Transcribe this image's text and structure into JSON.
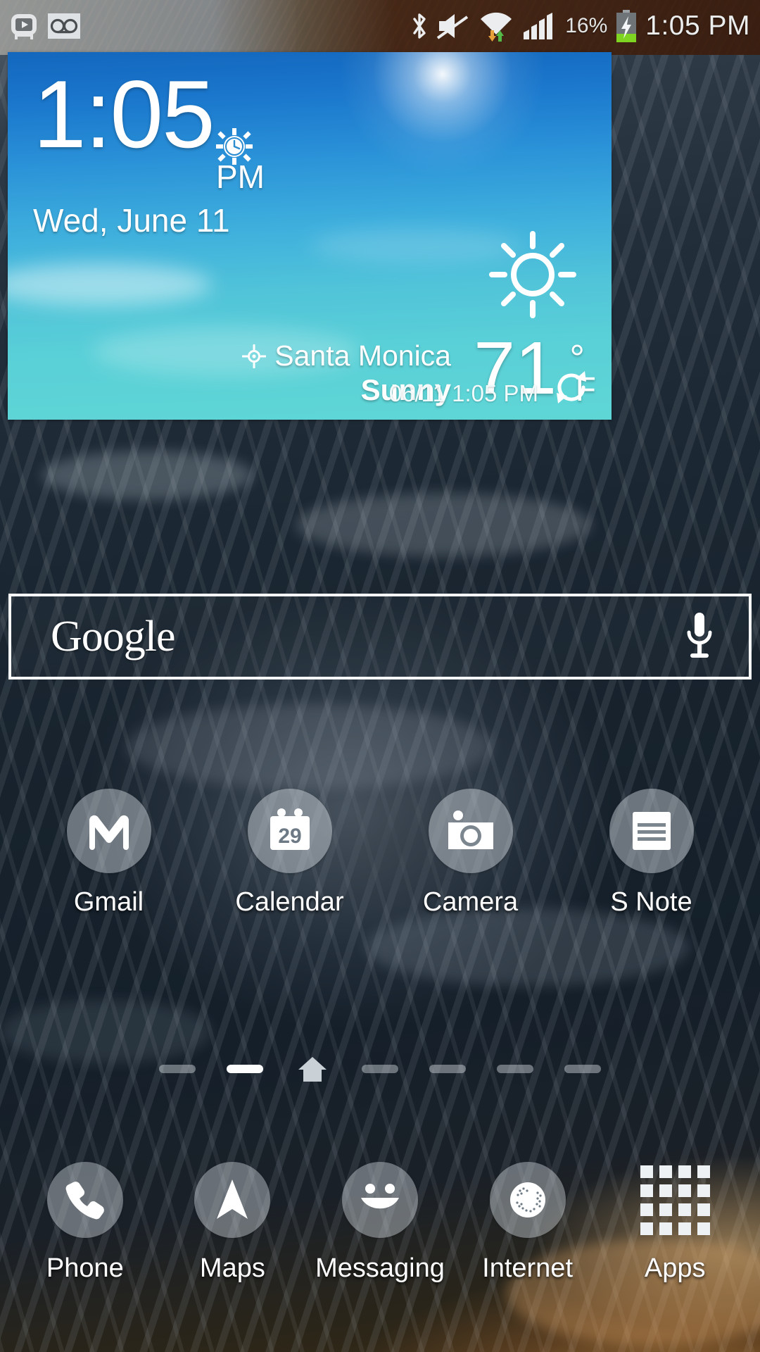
{
  "status_bar": {
    "left_icons": [
      {
        "name": "screen-recorder-icon",
        "label": "Screen recorder"
      },
      {
        "name": "voicemail-icon",
        "label": "Voicemail"
      }
    ],
    "right_icons": [
      {
        "name": "bluetooth-icon",
        "label": "Bluetooth"
      },
      {
        "name": "sound-mute-icon",
        "label": "Sound muted"
      },
      {
        "name": "wifi-icon",
        "label": "Wi-Fi with data transfer"
      },
      {
        "name": "cellular-signal-icon",
        "label": "Cellular signal"
      }
    ],
    "battery_percent": "16%",
    "battery_state": "charging",
    "clock": "1:05 PM"
  },
  "weather_widget": {
    "time": "1:05",
    "meridiem": "PM",
    "date": "Wed, June 11",
    "alarm_icon": "alarm-clock-icon",
    "condition_icon": "sunny-icon",
    "location": "Santa Monica",
    "condition": "Sunny",
    "temperature": "71",
    "degree_symbol": "°",
    "unit": "F",
    "updated": "06/11 1:05 PM",
    "refresh_icon": "refresh-icon"
  },
  "search": {
    "brand": "Google",
    "mic_icon": "microphone-icon"
  },
  "apps": [
    {
      "label": "Gmail",
      "icon": "gmail-icon"
    },
    {
      "label": "Calendar",
      "icon": "calendar-icon",
      "badge": "29"
    },
    {
      "label": "Camera",
      "icon": "camera-icon"
    },
    {
      "label": "S Note",
      "icon": "s-note-icon"
    }
  ],
  "page_indicator": {
    "pages": 7,
    "active_index": 1,
    "home_index": 2,
    "home_icon": "home-icon"
  },
  "dock": [
    {
      "label": "Phone",
      "icon": "phone-icon"
    },
    {
      "label": "Maps",
      "icon": "navigation-arrow-icon"
    },
    {
      "label": "Messaging",
      "icon": "smiley-face-icon"
    },
    {
      "label": "Internet",
      "icon": "globe-icon"
    },
    {
      "label": "Apps",
      "icon": "apps-grid-icon"
    }
  ],
  "colors": {
    "widget_top": "#1367bd",
    "widget_bottom": "#5fd6d6",
    "battery_charge": "#7fd321",
    "text_white": "#ffffff",
    "status_text": "#eceded"
  }
}
